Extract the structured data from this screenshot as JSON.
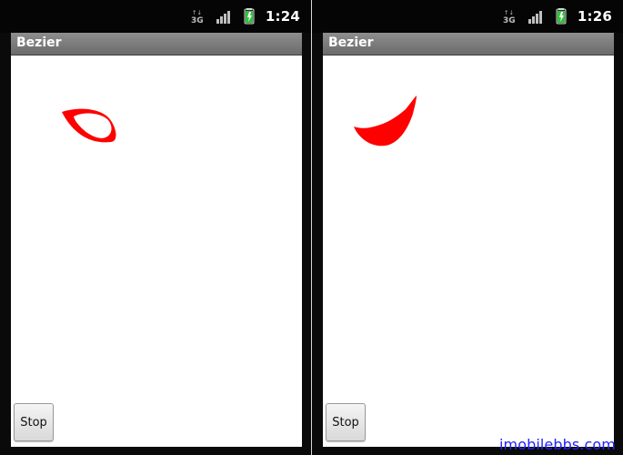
{
  "left": {
    "status_time": "1:24",
    "app_title": "Bezier",
    "button_label": "Stop"
  },
  "right": {
    "status_time": "1:26",
    "app_title": "Bezier",
    "button_label": "Stop"
  },
  "watermark": "imobilebbs.com",
  "colors": {
    "curve": "#ff0000",
    "titlebar": "#7b7b7b",
    "statusbar": "#050505",
    "battery": "#32c632"
  },
  "icons": [
    "3g-icon",
    "signal-icon",
    "battery-icon"
  ]
}
